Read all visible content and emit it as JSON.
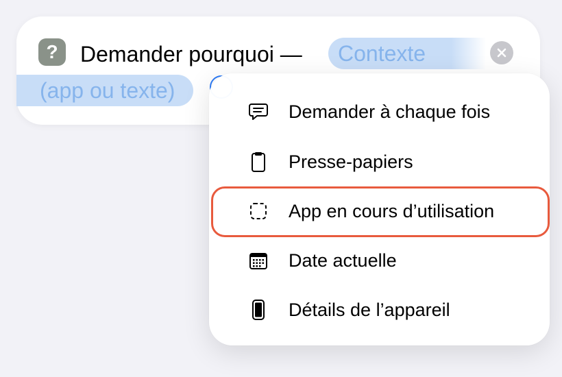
{
  "action": {
    "icon_glyph": "?",
    "icon_name": "question-mark-icon",
    "title": "Demander pourquoi —",
    "token_line1": "Contexte",
    "token_line2": "(app ou texte)"
  },
  "menu": {
    "items": [
      {
        "label": "Demander à chaque fois",
        "icon": "speech-bubble-icon"
      },
      {
        "label": "Presse-papiers",
        "icon": "clipboard-icon"
      },
      {
        "label": "App en cours d’utilisation",
        "icon": "dashed-square-icon"
      },
      {
        "label": "Date actuelle",
        "icon": "calendar-icon"
      },
      {
        "label": "Détails de l’appareil",
        "icon": "phone-icon"
      }
    ],
    "highlighted_index": 2
  },
  "colors": {
    "accent": "#2f7cf6",
    "token_bg": "#c8ddf7",
    "token_text": "#86b4ec",
    "highlight": "#e85a3d",
    "action_icon_bg": "#8a9289"
  }
}
